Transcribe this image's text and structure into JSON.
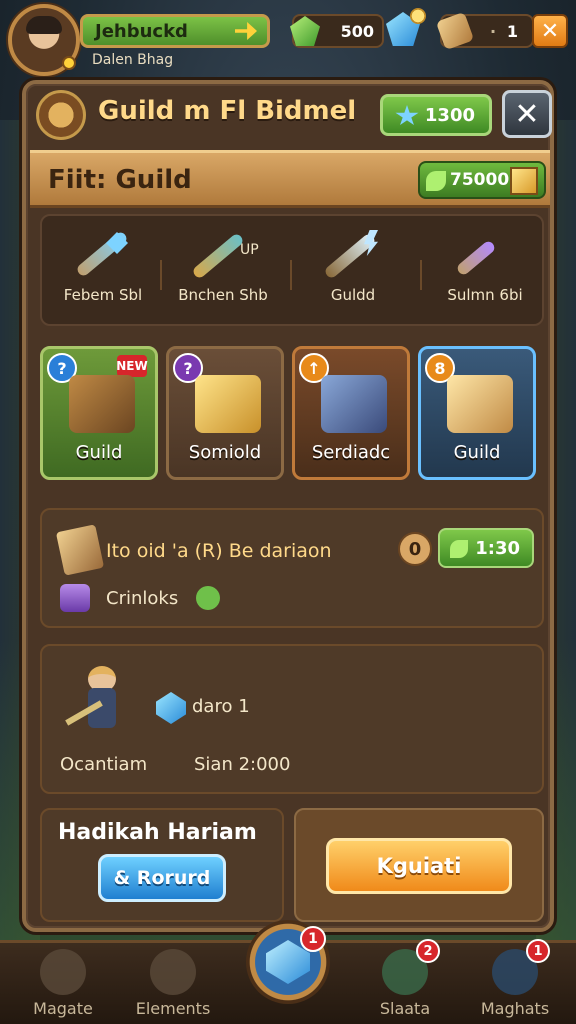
{
  "player": {
    "name": "Jehbuckd",
    "subtitle": "Dalen Bhag"
  },
  "resources": {
    "gems": "500",
    "scrolls": "1",
    "close_symbol": "✕"
  },
  "panel": {
    "title": "Guild m Fl Bidmel",
    "gem_value": "1300",
    "close_symbol": "✕",
    "banner_title": "Fiit: Guild",
    "banner_coins": "75000"
  },
  "weapons": [
    {
      "label": "Febem Sbl",
      "icon": "blue-spear-icon"
    },
    {
      "label": "Bnchen Shb",
      "icon": "crossbow-icon"
    },
    {
      "label": "Guldd",
      "icon": "lightning-sword-icon"
    },
    {
      "label": "Sulmn 6bi",
      "icon": "purple-staff-icon"
    }
  ],
  "weapon_extra_label": "UP",
  "cards": [
    {
      "label": "Guild",
      "badge": "?",
      "tag": "NEW",
      "icon": "treasure-chest-icon"
    },
    {
      "label": "Somiold",
      "badge": "?",
      "icon": "gift-box-icon"
    },
    {
      "label": "Serdiadc",
      "badge": "↑",
      "icon": "cannon-icon"
    },
    {
      "label": "Guild",
      "badge": "8",
      "icon": "golden-shield-icon"
    }
  ],
  "quest": {
    "title": "Ito oid 'a (R) Be dariaon",
    "sub": "Crinloks",
    "count": "0",
    "reward": "1:30"
  },
  "hero": {
    "gem_label": "daro 1",
    "stat1": "Ocantiam",
    "stat2": "Sian 2:000"
  },
  "bottom": {
    "left_title": "Hadikah Hariam",
    "left_button": "& Rorurd",
    "right_button": "Kguiati"
  },
  "nav": [
    {
      "label": "Magate",
      "badge": ""
    },
    {
      "label": "Elements",
      "badge": ""
    },
    {
      "label": "Slaata",
      "badge": "2"
    },
    {
      "label": "Maghats",
      "badge": "1"
    }
  ],
  "nav_center_badge": "1",
  "colors": {
    "panel": "#4a3525",
    "green_button": "#3f8a24",
    "blue_button": "#1f7fd0",
    "orange_button": "#f08a1a",
    "badge_red": "#d7262b"
  }
}
